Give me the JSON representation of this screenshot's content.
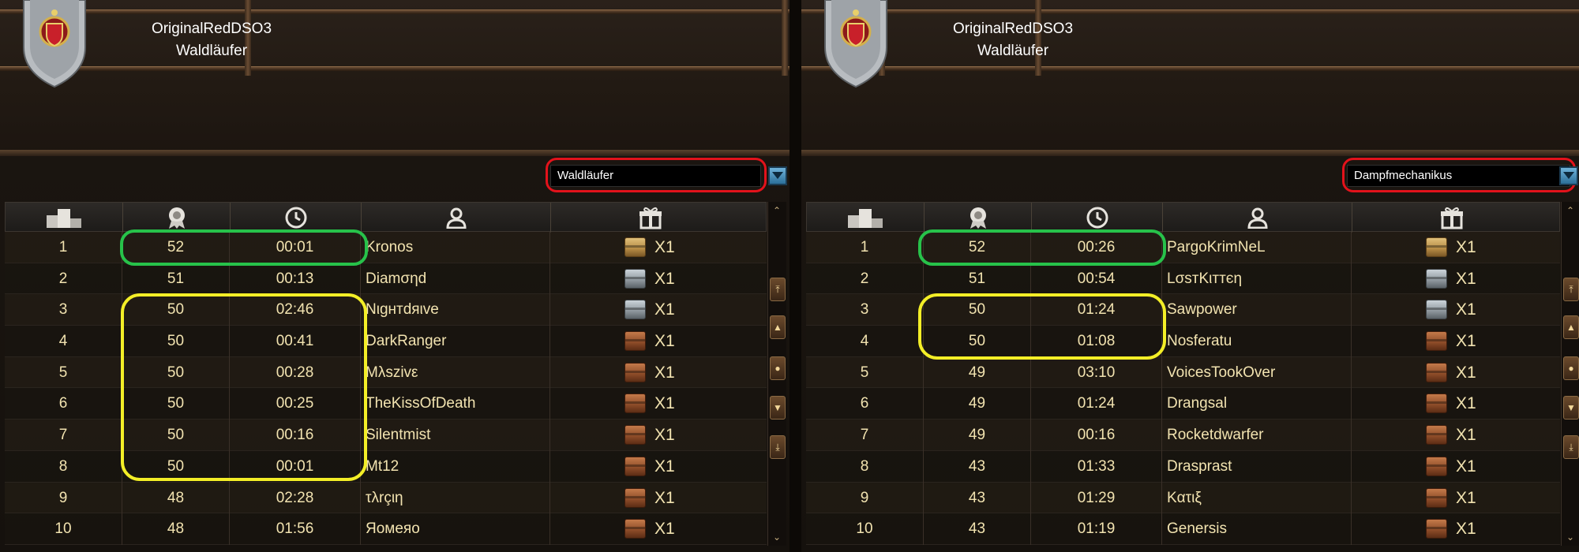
{
  "colors": {
    "outline_red": "#e3121b",
    "outline_green": "#27c24a",
    "outline_yellow": "#f3ee27",
    "text": "#f2e3b0"
  },
  "icons": {
    "rank": "podium-icon",
    "points": "medal-icon",
    "time": "clock-icon",
    "player": "user-icon",
    "reward": "gift-icon"
  },
  "panels": [
    {
      "player_name": "OriginalRedDSO3",
      "player_class": "Waldläufer",
      "dropdown_value": "Waldläufer",
      "rows": [
        {
          "rank": "1",
          "points": "52",
          "time": "00:01",
          "name": "Kronos",
          "chest": "gold",
          "reward": "X1"
        },
        {
          "rank": "2",
          "points": "51",
          "time": "00:13",
          "name": "Diamσηd",
          "chest": "silver",
          "reward": "X1"
        },
        {
          "rank": "3",
          "points": "50",
          "time": "02:46",
          "name": "Nιgнтdяιve",
          "chest": "silver",
          "reward": "X1"
        },
        {
          "rank": "4",
          "points": "50",
          "time": "00:41",
          "name": "DarkRanger",
          "chest": "bronze",
          "reward": "X1"
        },
        {
          "rank": "5",
          "points": "50",
          "time": "00:28",
          "name": "Mλszivε",
          "chest": "bronze",
          "reward": "X1"
        },
        {
          "rank": "6",
          "points": "50",
          "time": "00:25",
          "name": "TheKissOfDeath",
          "chest": "bronze",
          "reward": "X1"
        },
        {
          "rank": "7",
          "points": "50",
          "time": "00:16",
          "name": "Silentmist",
          "chest": "bronze",
          "reward": "X1"
        },
        {
          "rank": "8",
          "points": "50",
          "time": "00:01",
          "name": "Mt12",
          "chest": "bronze",
          "reward": "X1"
        },
        {
          "rank": "9",
          "points": "48",
          "time": "02:28",
          "name": "τλrçιη",
          "chest": "bronze",
          "reward": "X1"
        },
        {
          "rank": "10",
          "points": "48",
          "time": "01:56",
          "name": "Яомеяо",
          "chest": "bronze",
          "reward": "X1"
        }
      ]
    },
    {
      "player_name": "OriginalRedDSO3",
      "player_class": "Waldläufer",
      "dropdown_value": "Dampfmechanikus",
      "rows": [
        {
          "rank": "1",
          "points": "52",
          "time": "00:26",
          "name": "PargoKrimNeL",
          "chest": "gold",
          "reward": "X1"
        },
        {
          "rank": "2",
          "points": "51",
          "time": "00:54",
          "name": "LσѕтKιттєη",
          "chest": "silver",
          "reward": "X1"
        },
        {
          "rank": "3",
          "points": "50",
          "time": "01:24",
          "name": "Sawpower",
          "chest": "silver",
          "reward": "X1"
        },
        {
          "rank": "4",
          "points": "50",
          "time": "01:08",
          "name": "Nosferatu",
          "chest": "bronze",
          "reward": "X1"
        },
        {
          "rank": "5",
          "points": "49",
          "time": "03:10",
          "name": "VoicesTookOver",
          "chest": "bronze",
          "reward": "X1"
        },
        {
          "rank": "6",
          "points": "49",
          "time": "01:24",
          "name": "Drangsal",
          "chest": "bronze",
          "reward": "X1"
        },
        {
          "rank": "7",
          "points": "49",
          "time": "00:16",
          "name": "Rocketdwarfer",
          "chest": "bronze",
          "reward": "X1"
        },
        {
          "rank": "8",
          "points": "43",
          "time": "01:33",
          "name": "Drasprast",
          "chest": "bronze",
          "reward": "X1"
        },
        {
          "rank": "9",
          "points": "43",
          "time": "01:29",
          "name": "Kατιξ",
          "chest": "bronze",
          "reward": "X1"
        },
        {
          "rank": "10",
          "points": "43",
          "time": "01:19",
          "name": "Genersis",
          "chest": "bronze",
          "reward": "X1"
        }
      ]
    }
  ]
}
